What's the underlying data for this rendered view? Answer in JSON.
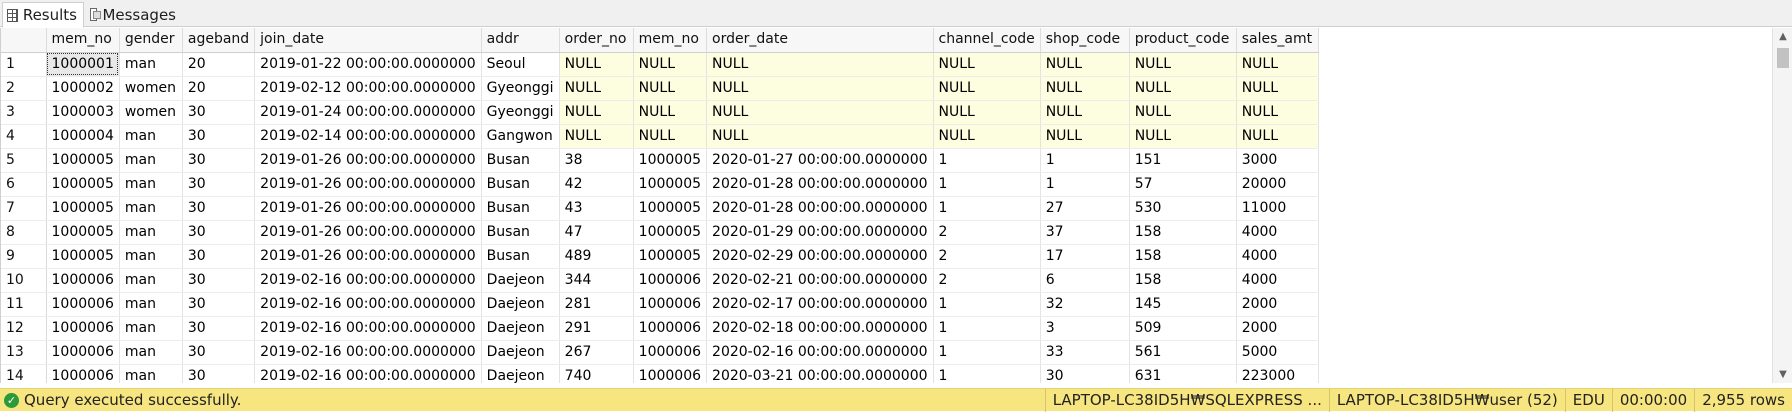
{
  "tabs": [
    {
      "label": "Results",
      "icon": "grid-icon"
    },
    {
      "label": "Messages",
      "icon": "messages-icon"
    }
  ],
  "grid": {
    "columns": [
      "mem_no",
      "gender",
      "ageband",
      "join_date",
      "addr",
      "order_no",
      "mem_no",
      "order_date",
      "channel_code",
      "shop_code",
      "product_code",
      "sales_amt"
    ],
    "rows": [
      [
        "1",
        "1000001",
        "man",
        "20",
        "2019-01-22 00:00:00.0000000",
        "Seoul",
        "NULL",
        "NULL",
        "NULL",
        "NULL",
        "NULL",
        "NULL",
        "NULL"
      ],
      [
        "2",
        "1000002",
        "women",
        "20",
        "2019-02-12 00:00:00.0000000",
        "Gyeonggi",
        "NULL",
        "NULL",
        "NULL",
        "NULL",
        "NULL",
        "NULL",
        "NULL"
      ],
      [
        "3",
        "1000003",
        "women",
        "30",
        "2019-01-24 00:00:00.0000000",
        "Gyeonggi",
        "NULL",
        "NULL",
        "NULL",
        "NULL",
        "NULL",
        "NULL",
        "NULL"
      ],
      [
        "4",
        "1000004",
        "man",
        "30",
        "2019-02-14 00:00:00.0000000",
        "Gangwon",
        "NULL",
        "NULL",
        "NULL",
        "NULL",
        "NULL",
        "NULL",
        "NULL"
      ],
      [
        "5",
        "1000005",
        "man",
        "30",
        "2019-01-26 00:00:00.0000000",
        "Busan",
        "38",
        "1000005",
        "2020-01-27 00:00:00.0000000",
        "1",
        "1",
        "151",
        "3000"
      ],
      [
        "6",
        "1000005",
        "man",
        "30",
        "2019-01-26 00:00:00.0000000",
        "Busan",
        "42",
        "1000005",
        "2020-01-28 00:00:00.0000000",
        "1",
        "1",
        "57",
        "20000"
      ],
      [
        "7",
        "1000005",
        "man",
        "30",
        "2019-01-26 00:00:00.0000000",
        "Busan",
        "43",
        "1000005",
        "2020-01-28 00:00:00.0000000",
        "1",
        "27",
        "530",
        "11000"
      ],
      [
        "8",
        "1000005",
        "man",
        "30",
        "2019-01-26 00:00:00.0000000",
        "Busan",
        "47",
        "1000005",
        "2020-01-29 00:00:00.0000000",
        "2",
        "37",
        "158",
        "4000"
      ],
      [
        "9",
        "1000005",
        "man",
        "30",
        "2019-01-26 00:00:00.0000000",
        "Busan",
        "489",
        "1000005",
        "2020-02-29 00:00:00.0000000",
        "2",
        "17",
        "158",
        "4000"
      ],
      [
        "10",
        "1000006",
        "man",
        "30",
        "2019-02-16 00:00:00.0000000",
        "Daejeon",
        "344",
        "1000006",
        "2020-02-21 00:00:00.0000000",
        "2",
        "6",
        "158",
        "4000"
      ],
      [
        "11",
        "1000006",
        "man",
        "30",
        "2019-02-16 00:00:00.0000000",
        "Daejeon",
        "281",
        "1000006",
        "2020-02-17 00:00:00.0000000",
        "1",
        "32",
        "145",
        "2000"
      ],
      [
        "12",
        "1000006",
        "man",
        "30",
        "2019-02-16 00:00:00.0000000",
        "Daejeon",
        "291",
        "1000006",
        "2020-02-18 00:00:00.0000000",
        "1",
        "3",
        "509",
        "2000"
      ],
      [
        "13",
        "1000006",
        "man",
        "30",
        "2019-02-16 00:00:00.0000000",
        "Daejeon",
        "267",
        "1000006",
        "2020-02-16 00:00:00.0000000",
        "1",
        "33",
        "561",
        "5000"
      ],
      [
        "14",
        "1000006",
        "man",
        "30",
        "2019-02-16 00:00:00.0000000",
        "Daejeon",
        "740",
        "1000006",
        "2020-03-21 00:00:00.0000000",
        "1",
        "30",
        "631",
        "223000"
      ]
    ],
    "null_highlight_color": "#fdfde0"
  },
  "status": {
    "message": "Query executed successfully.",
    "icon": "check-circle-icon",
    "server": "LAPTOP-LC38ID5H₩SQLEXPRESS ...",
    "user": "LAPTOP-LC38ID5H₩user (52)",
    "database": "EDU",
    "elapsed": "00:00:00",
    "rows": "2,955 rows",
    "bar_color": "#f7e680"
  }
}
